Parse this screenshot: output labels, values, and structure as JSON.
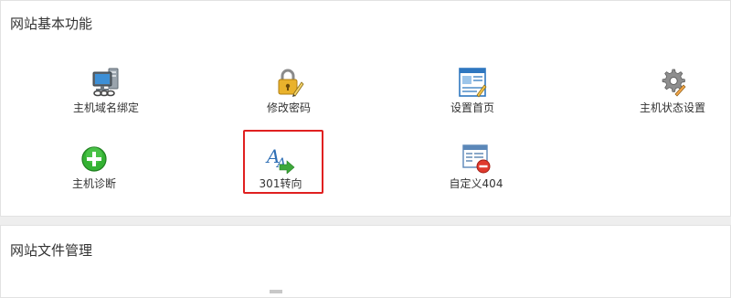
{
  "colors": {
    "page_bg": "#eeeeee",
    "panel_bg": "#ffffff",
    "highlight": "#e02020"
  },
  "panels": {
    "basic": {
      "title": "网站基本功能",
      "items": [
        {
          "label": "主机域名绑定",
          "icon": "host-computer-icon"
        },
        {
          "label": "修改密码",
          "icon": "lock-pencil-icon"
        },
        {
          "label": "设置首页",
          "icon": "homepage-layout-icon"
        },
        {
          "label": "主机状态设置",
          "icon": "gear-icon"
        },
        {
          "label": "主机诊断",
          "icon": "green-plus-icon"
        },
        {
          "label": "301转向",
          "icon": "redirect-arrow-icon",
          "highlighted": true
        },
        {
          "label": "自定义404",
          "icon": "window-minus-icon"
        }
      ]
    },
    "files": {
      "title": "网站文件管理"
    }
  }
}
